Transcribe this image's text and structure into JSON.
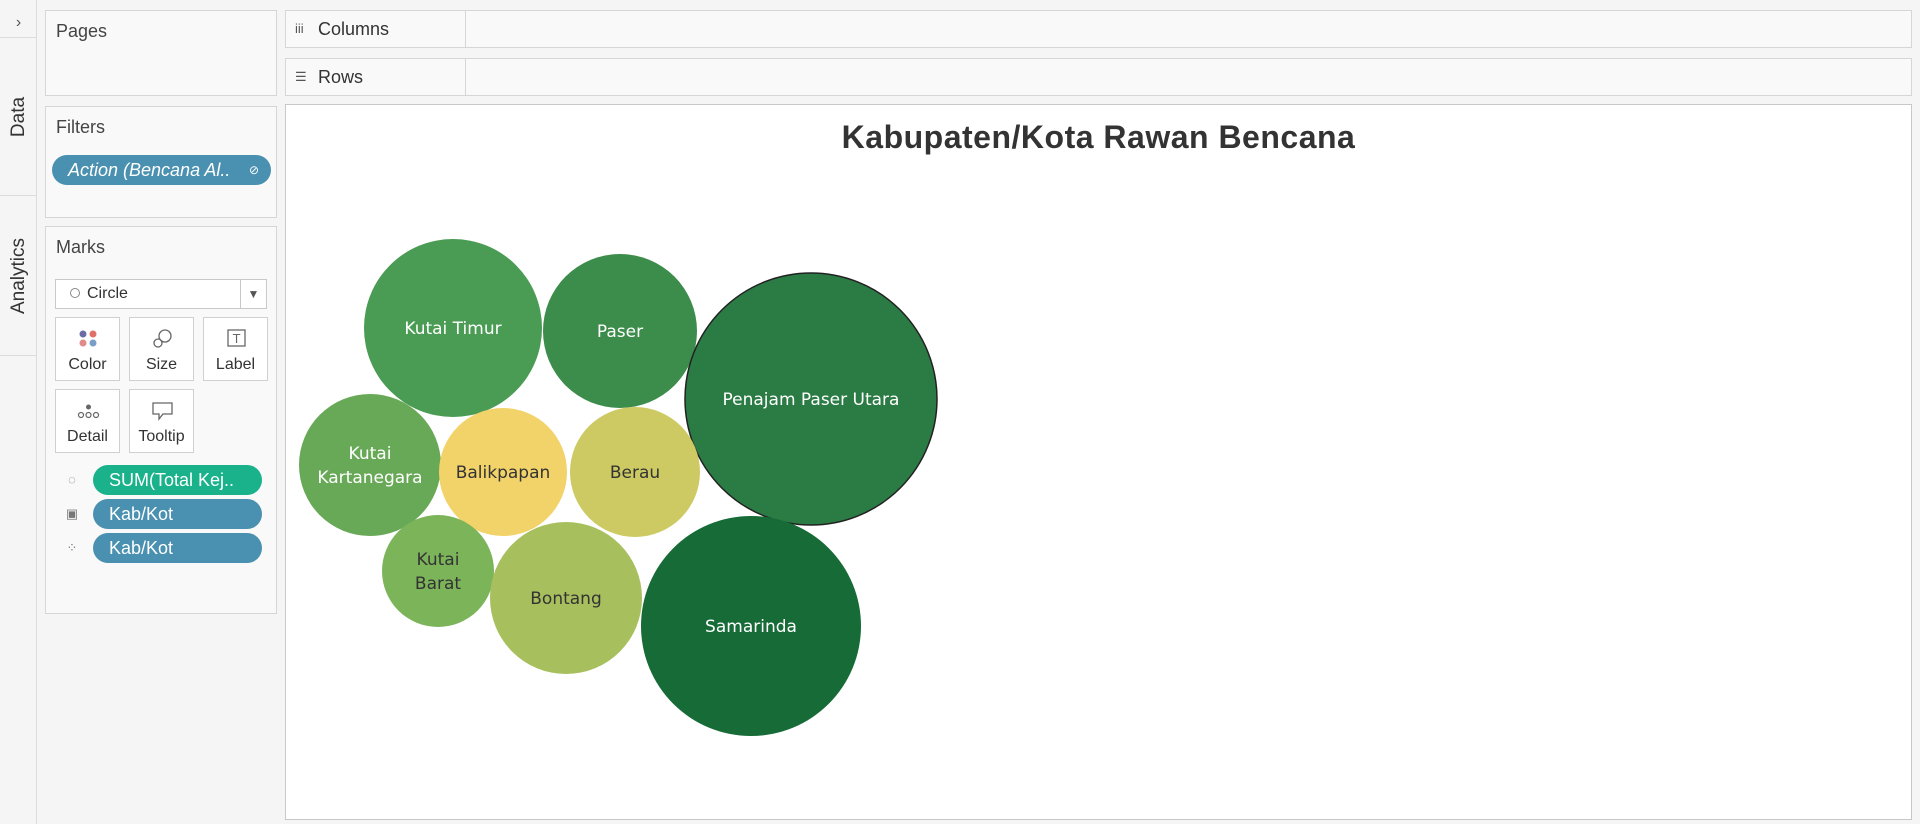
{
  "rail": {
    "toggle": "›",
    "tabs": [
      "Data",
      "Analytics"
    ]
  },
  "pages_card": {
    "title": "Pages"
  },
  "filters_card": {
    "title": "Filters",
    "pill": "Action (Bencana Al..",
    "pill_icon": "link-icon"
  },
  "marks_card": {
    "title": "Marks",
    "mark_type": "Circle",
    "buttons": [
      "Color",
      "Size",
      "Label",
      "Detail",
      "Tooltip"
    ],
    "shelf": [
      {
        "icon": "size-icon",
        "label": "SUM(Total Kej..",
        "color": "#19b28b"
      },
      {
        "icon": "label-icon",
        "label": "Kab/Kot",
        "color": "#4a90b0"
      },
      {
        "icon": "color-icon",
        "label": "Kab/Kot",
        "color": "#4a90b0"
      }
    ]
  },
  "shelves": {
    "columns": "Columns",
    "rows": "Rows"
  },
  "viz": {
    "title": "Kabupaten/Kota Rawan Bencana",
    "bubbles": [
      {
        "lines": [
          "Kutai Timur"
        ],
        "color": "#4a9b53",
        "text_color": "#ffffff"
      },
      {
        "lines": [
          "Paser"
        ],
        "color": "#3c8c4b",
        "text_color": "#ffffff"
      },
      {
        "lines": [
          "Penajam Paser Utara"
        ],
        "color": "#2b7b45",
        "text_color": "#ffffff",
        "selected": true
      },
      {
        "lines": [
          "Kutai",
          "Kartanegara"
        ],
        "color": "#68a957",
        "text_color": "#ffffff"
      },
      {
        "lines": [
          "Balikpapan"
        ],
        "color": "#f2d36a",
        "text_color": "#333333"
      },
      {
        "lines": [
          "Berau"
        ],
        "color": "#cdca64",
        "text_color": "#333333"
      },
      {
        "lines": [
          "Kutai",
          "Barat"
        ],
        "color": "#7cb45a",
        "text_color": "#333333"
      },
      {
        "lines": [
          "Bontang"
        ],
        "color": "#a8bf5e",
        "text_color": "#333333"
      },
      {
        "lines": [
          "Samarinda"
        ],
        "color": "#176b37",
        "text_color": "#ffffff"
      }
    ]
  }
}
